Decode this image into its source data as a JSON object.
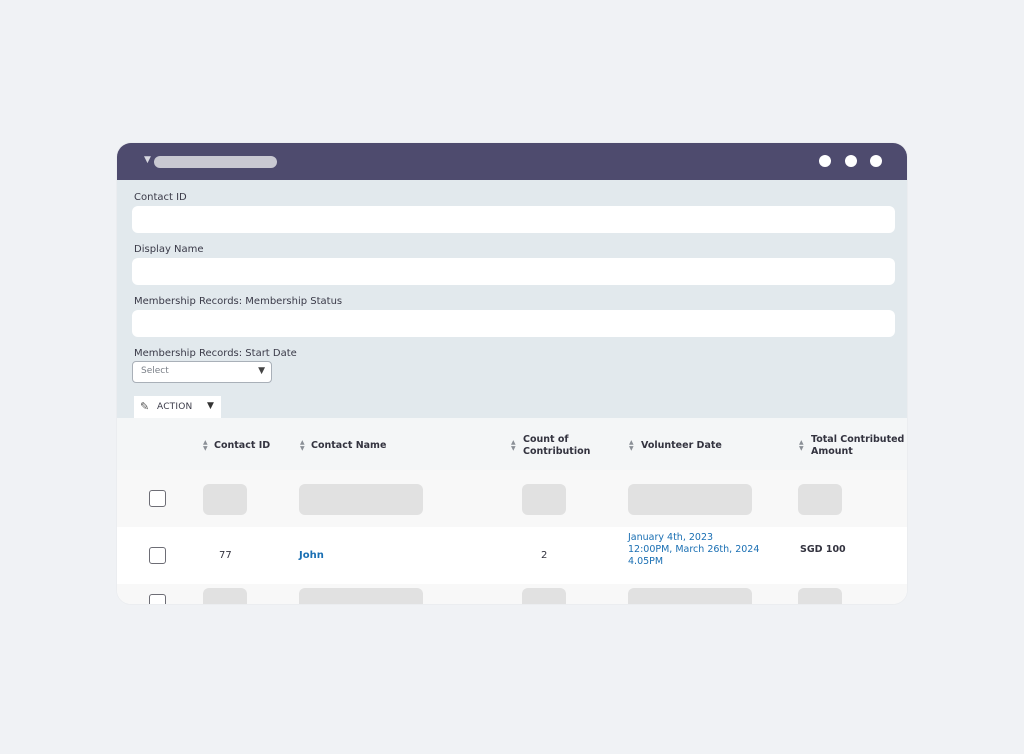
{
  "filters": {
    "contact_id_label": "Contact ID",
    "display_name_label": "Display Name",
    "membership_status_label": "Membership Records: Membership Status",
    "start_date_label": "Membership Records: Start Date",
    "start_date_placeholder": "Select"
  },
  "action": {
    "label": "ACTION"
  },
  "table": {
    "headers": {
      "contact_id": "Contact ID",
      "contact_name": "Contact Name",
      "count_line1": "Count of",
      "count_line2": "Contribution",
      "volunteer_date": "Volunteer Date",
      "total_line1": "Total Contributed",
      "total_line2": "Amount"
    },
    "rows": [
      {
        "contact_id": "77",
        "contact_name": "John",
        "count": "2",
        "volunteer_dates": [
          "January 4th, 2023",
          "12:00PM, March 26th, 2024",
          "4.05PM"
        ],
        "total": "SGD 100"
      }
    ]
  },
  "colors": {
    "titlebar": "#4e4b6e",
    "filters_bg": "#e2e9ed",
    "link": "#1a6fb3"
  },
  "icons": {
    "collapse": "caret-down-icon",
    "action": "pencil-icon",
    "window_controls": "dot-icon"
  }
}
